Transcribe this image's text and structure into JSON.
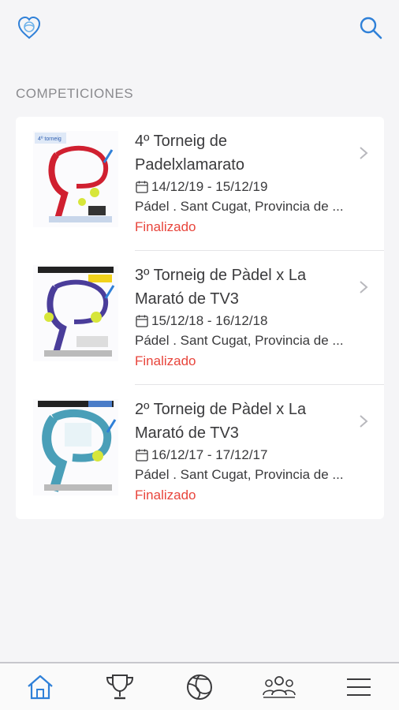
{
  "header": {
    "logo_icon": "heart-ball-logo",
    "search_icon": "search-icon",
    "accent": "#2f80d8"
  },
  "section": {
    "title": "COMPETICIONES"
  },
  "competitions": [
    {
      "title": "4º Torneig de Padelxlamarato",
      "dates": "14/12/19 - 15/12/19",
      "place": "Pádel . Sant Cugat, Provincia de ...",
      "status": "Finalizado"
    },
    {
      "title": "3º Torneig de Pàdel x La Marató de TV3",
      "dates": "15/12/18 - 16/12/18",
      "place": "Pádel . Sant Cugat, Provincia de ...",
      "status": "Finalizado"
    },
    {
      "title": "2º Torneig de Pàdel x La Marató de TV3",
      "dates": "16/12/17 - 17/12/17",
      "place": "Pádel . Sant Cugat, Provincia de ...",
      "status": "Finalizado"
    }
  ],
  "tabbar": {
    "items": [
      "home-icon",
      "trophy-icon",
      "ball-icon",
      "community-icon",
      "menu-icon"
    ],
    "active": "home-icon"
  },
  "colors": {
    "status": "#e8453c",
    "active_tab": "#2f80d8",
    "inactive_tab": "#3a3a3c"
  }
}
